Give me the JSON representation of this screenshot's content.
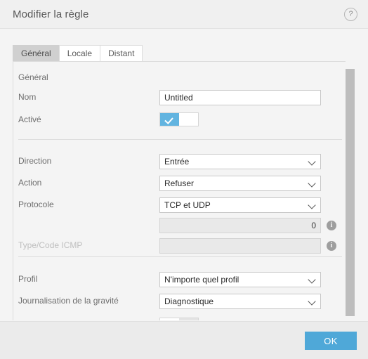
{
  "window": {
    "title": "Modifier la règle",
    "help_icon": "question-mark-icon",
    "help_label": "?"
  },
  "tabs": [
    {
      "label": "Général",
      "active": true
    },
    {
      "label": "Locale",
      "active": false
    },
    {
      "label": "Distant",
      "active": false
    }
  ],
  "form": {
    "section_title": "Général",
    "fields": {
      "name": {
        "label": "Nom",
        "value": "Untitled",
        "placeholder": ""
      },
      "enabled": {
        "label": "Activé",
        "checked": true
      },
      "direction": {
        "label": "Direction",
        "value": "Entrée"
      },
      "action": {
        "label": "Action",
        "value": "Refuser"
      },
      "protocol": {
        "label": "Protocole",
        "value": "TCP et UDP"
      },
      "port_number": {
        "label": "",
        "value": "0",
        "disabled": true,
        "info": "i"
      },
      "icmp": {
        "label": "Type/Code ICMP",
        "value": "",
        "disabled": true,
        "info": "i"
      },
      "profile": {
        "label": "Profil",
        "value": "N'importe quel profil"
      },
      "severity_log": {
        "label": "Journalisation de la gravité",
        "value": "Diagnostique"
      }
    }
  },
  "footer": {
    "ok_label": "OK"
  },
  "colors": {
    "accent": "#4fa8d8",
    "toggle_on": "#62b4e0",
    "window_bg": "#f4f4f4",
    "footer_bg": "#ebebeb",
    "active_tab": "#d0d0d0"
  }
}
